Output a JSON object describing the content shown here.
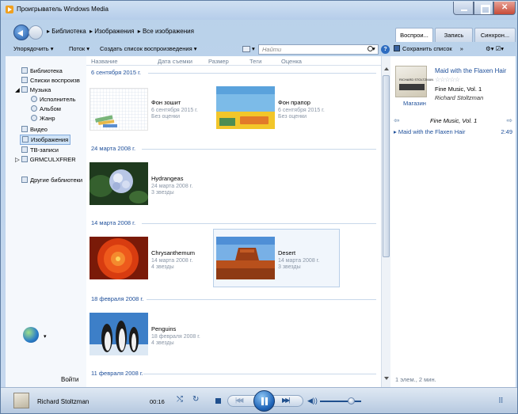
{
  "window": {
    "title": "Проигрыватель Windows Media"
  },
  "nav": {
    "breadcrumb": [
      "▸ Библиотека",
      "▸ Изображения",
      "▸ Все изображения"
    ],
    "tabs": [
      {
        "label": "Воспрои...",
        "active": true
      },
      {
        "label": "Запись",
        "active": false
      },
      {
        "label": "Синхрон...",
        "active": false
      }
    ]
  },
  "toolbar": {
    "organize": "Упорядочить ▾",
    "stream": "Поток ▾",
    "create_playlist": "Создать список воспроизведения ▾",
    "view_arrow": "▾",
    "search_placeholder": "Найти",
    "search_arrow": "▾",
    "help": "?",
    "save_list": "Сохранить список",
    "save_more": "»",
    "right_icons": "⚙▾ ☑▾"
  },
  "sidebar": {
    "items": [
      {
        "label": "Библиотека"
      },
      {
        "label": "Списки воспроизв"
      },
      {
        "label": "Музыка",
        "expander": "◢"
      },
      {
        "label": "Исполнитель"
      },
      {
        "label": "Альбом"
      },
      {
        "label": "Жанр"
      },
      {
        "label": "Видео"
      },
      {
        "label": "Изображения",
        "selected": true
      },
      {
        "label": "ТВ-записи"
      },
      {
        "label": "GRMCULXFRER",
        "expander": "▷"
      },
      {
        "label": "Другие библиотеки"
      }
    ],
    "globe_arrow": "▾",
    "signin": "Войти"
  },
  "columns": [
    "Название",
    "Дата съемки",
    "Размер",
    "Теги",
    "Оценка"
  ],
  "groups": [
    {
      "date": "6 сентября 2015 г.",
      "items": [
        {
          "name": "Фон зошит",
          "date": "6 сентября 2015 г.",
          "rating": "Без оценки"
        },
        {
          "name": "Фон прапор",
          "date": "6 сентября 2015 г.",
          "rating": "Без оценки"
        }
      ]
    },
    {
      "date": "24 марта 2008 г.",
      "items": [
        {
          "name": "Hydrangeas",
          "date": "24 марта 2008 г.",
          "rating": "3 звезды"
        }
      ]
    },
    {
      "date": "14 марта 2008 г.",
      "items": [
        {
          "name": "Chrysanthemum",
          "date": "14 марта 2008 г.",
          "rating": "4 звезды"
        },
        {
          "name": "Desert",
          "date": "14 марта 2008 г.",
          "rating": "3 звезды"
        }
      ]
    },
    {
      "date": "18 февраля 2008 г.",
      "items": [
        {
          "name": "Penguins",
          "date": "18 февраля 2008 г.",
          "rating": "4 звезды"
        }
      ]
    },
    {
      "date": "11 февраля 2008 г.",
      "items": []
    }
  ],
  "now_playing": {
    "title": "Maid with the Flaxen Hair",
    "stars": "☆☆☆☆☆",
    "album": "Fine Music, Vol. 1",
    "artist": "Richard Stoltzman",
    "store": "Магазин",
    "art_caption": "RICHARD STOLTZMAN",
    "rating_stars": 0
  },
  "playlist": {
    "title": "Fine Music, Vol. 1",
    "prev": "⇦",
    "next": "⇨",
    "items": [
      {
        "marker": "▸",
        "title": "Maid with the Flaxen Hair",
        "duration": "2:49"
      }
    ],
    "status": "1 элем., 2 мин."
  },
  "player": {
    "artist": "Richard Stoltzman",
    "time": "00:16",
    "shuffle": "⤭",
    "repeat": "↻",
    "prev": "|◀◀",
    "next": "▶▶|",
    "volume_icon": "◀))",
    "volume": 0.75,
    "switch": "⠿"
  },
  "colors": {
    "accent": "#1e4f9a",
    "frame": "#b9d1ea"
  }
}
